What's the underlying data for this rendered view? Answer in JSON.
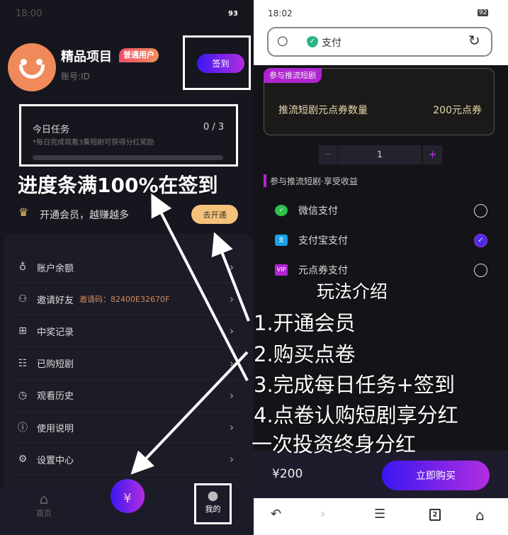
{
  "left": {
    "status": {
      "time": "18:00",
      "battery": "93"
    },
    "profile": {
      "name": "精品项目",
      "badge": "普通用户",
      "account": "账号:ID"
    },
    "checkin_label": "签到",
    "task": {
      "title": "今日任务",
      "count": "0 / 3",
      "desc": "*每日完成观看3集短剧可获得分红奖励",
      "progress": 0
    },
    "member": {
      "text": "开通会员，越赚越多",
      "button": "去开通"
    },
    "menu": [
      {
        "icon": "money-bag-icon",
        "label": "账户余额"
      },
      {
        "icon": "add-user-icon",
        "label": "邀请好友",
        "extra": "邀请码：82400E32670F"
      },
      {
        "icon": "gift-icon",
        "label": "中奖记录"
      },
      {
        "icon": "list-icon",
        "label": "已购短剧"
      },
      {
        "icon": "clock-icon",
        "label": "观看历史"
      },
      {
        "icon": "info-icon",
        "label": "使用说明"
      },
      {
        "icon": "gear-icon",
        "label": "设置中心"
      }
    ],
    "nav": {
      "home": "首页",
      "mine": "我的"
    }
  },
  "right": {
    "status": {
      "time": "18:02",
      "battery": "92"
    },
    "address": "支付",
    "card": {
      "tag": "参与推流短剧",
      "label": "推流短剧元点券数量",
      "value": "200元点券"
    },
    "quantity": "1",
    "section": "参与推流短剧·享受收益",
    "payments": [
      {
        "icon": "wechat-pay-icon",
        "label": "微信支付",
        "selected": false
      },
      {
        "icon": "alipay-icon",
        "label": "支付宝支付",
        "selected": true
      },
      {
        "icon": "vip-voucher-icon",
        "label": "元点券支付",
        "selected": false
      }
    ],
    "price": "¥200",
    "buy": "立即购买",
    "tabs_count": "2"
  },
  "annotations": {
    "progress_note": "进度条满100%在签到",
    "guide_title": "玩法介绍",
    "steps": [
      "1.开通会员",
      "2.购买点卷",
      "3.完成每日任务+签到",
      "4.点卷认购短剧享分红",
      "一次投资终身分红"
    ]
  },
  "colors": {
    "accent_start": "#3b17f0",
    "accent_end": "#b12ee0",
    "avatar": "#f08a5a",
    "member_button": "#f5c27a",
    "tag": "#b025d0"
  }
}
